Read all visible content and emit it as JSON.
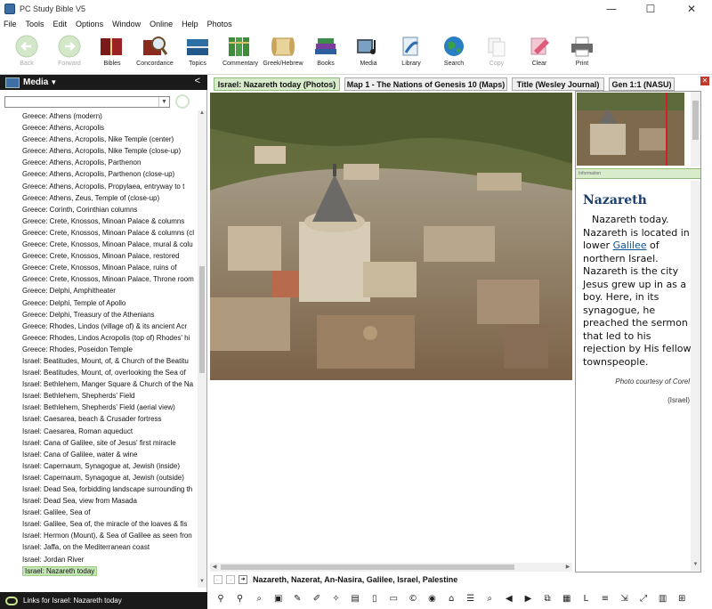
{
  "window": {
    "title": "PC Study Bible V5",
    "controls": {
      "minimize": "—",
      "maximize": "☐",
      "close": "✕"
    }
  },
  "menu": [
    "File",
    "Tools",
    "Edit",
    "Options",
    "Window",
    "Online",
    "Help",
    "Photos"
  ],
  "toolbar": [
    {
      "label": "Back",
      "icon": "back-arrow-icon",
      "enabled": false
    },
    {
      "label": "Forward",
      "icon": "forward-arrow-icon",
      "enabled": false
    },
    {
      "label": "Bibles",
      "icon": "bibles-icon",
      "enabled": true
    },
    {
      "label": "Concordance",
      "icon": "concordance-icon",
      "enabled": true
    },
    {
      "label": "Topics",
      "icon": "topics-icon",
      "enabled": true
    },
    {
      "label": "Commentary",
      "icon": "commentary-icon",
      "enabled": true
    },
    {
      "label": "Greek/Hebrew",
      "icon": "greek-hebrew-icon",
      "enabled": true
    },
    {
      "label": "Books",
      "icon": "books-icon",
      "enabled": true
    },
    {
      "label": "Media",
      "icon": "media-icon",
      "enabled": true
    },
    {
      "label": "Library",
      "icon": "library-icon",
      "enabled": true
    },
    {
      "label": "Search",
      "icon": "search-globe-icon",
      "enabled": true
    },
    {
      "label": "Copy",
      "icon": "copy-icon",
      "enabled": false
    },
    {
      "label": "Clear",
      "icon": "clear-icon",
      "enabled": true
    },
    {
      "label": "Print",
      "icon": "print-icon",
      "enabled": true
    }
  ],
  "left_panel": {
    "title": "Media",
    "collapse": "<",
    "search": {
      "value": "",
      "placeholder": ""
    },
    "items": [
      "Greece: Athens (modern)",
      "Greece: Athens, Acropolis",
      "Greece: Athens, Acropolis, Nike Temple (center)",
      "Greece: Athens, Acropolis, Nike Temple (close-up)",
      "Greece: Athens, Acropolis, Parthenon",
      "Greece: Athens, Acropolis, Parthenon (close-up)",
      "Greece: Athens, Acropolis, Propylaea, entryway to t",
      "Greece: Athens, Zeus, Temple of (close-up)",
      "Greece: Corinth, Corinthian columns",
      "Greece: Crete, Knossos, Minoan Palace & columns",
      "Greece: Crete, Knossos, Minoan Palace & columns (cl",
      "Greece: Crete, Knossos, Minoan Palace, mural & colu",
      "Greece: Crete, Knossos, Minoan Palace, restored",
      "Greece: Crete, Knossos, Minoan Palace, ruins of",
      "Greece: Crete, Knossos, Minoan Palace, Throne room",
      "Greece: Delphi, Amphitheater",
      "Greece: Delphi, Temple of Apollo",
      "Greece: Delphi, Treasury of the Athenians",
      "Greece: Rhodes, Lindos (village of) & its ancient Acr",
      "Greece: Rhodes, Lindos Acropolis (top of) Rhodes' hi",
      "Greece: Rhodes, Poseidon Temple",
      "Israel: Beatitudes, Mount, of, & Church of the Beatitu",
      "Israel: Beatitudes, Mount, of, overlooking the Sea of",
      "Israel: Bethlehem, Manger Square & Church of the Na",
      "Israel: Bethlehem, Shepherds' Field",
      "Israel: Bethlehem, Shepherds' Field (aerial view)",
      "Israel: Caesarea, beach & Crusader fortress",
      "Israel: Caesarea, Roman aqueduct",
      "Israel: Cana of Galilee, site of Jesus' first miracle",
      "Israel: Cana of Galilee, water & wine",
      "Israel: Capernaum, Synagogue at, Jewish (inside)",
      "Israel: Capernaum, Synagogue at, Jewish (outside)",
      "Israel: Dead Sea, forbidding landscape surrounding th",
      "Israel: Dead Sea, view from Masada",
      "Israel: Galilee, Sea of",
      "Israel: Galilee, Sea of, the miracle of the loaves & fis",
      "Israel: Hermon (Mount), & Sea of Galilee as seen fron",
      "Israel: Jaffa, on the Mediterranean coast",
      "Israel: Jordan River",
      "Israel: Nazareth today"
    ],
    "selected_index": 39,
    "footer": "Links for Israel: Nazareth today"
  },
  "tabs": [
    {
      "label": "Israel: Nazareth today (Photos)",
      "active": true
    },
    {
      "label": "Map 1 - The Nations of Genesis 10 (Maps)",
      "active": false
    },
    {
      "label": "Title (Wesley Journal)",
      "active": false
    },
    {
      "label": "Gen 1:1 (NASU)",
      "active": false
    }
  ],
  "tab_close": "✕",
  "info_bar_label": "Information",
  "article": {
    "heading": "Nazareth",
    "body_pre": "Nazareth today. Nazareth is located in lower ",
    "body_link": "Galilee",
    "body_post": " of northern Israel. Nazareth is the city Jesus grew up in as a boy. Here, in its synagogue, he preached the sermon that led to his rejection by His fellow townspeople.",
    "credit": "Photo courtesy of Corel",
    "region": "(Israel)"
  },
  "keywords": "Nazareth, Nazerat, An-Nasira, Galilee, Israel, Palestine",
  "keyword_nav": [
    "←",
    "→",
    "➜"
  ],
  "bottom_icons": [
    {
      "name": "find-icon",
      "glyph": "⚲"
    },
    {
      "name": "zoom-search-icon",
      "glyph": "⚲"
    },
    {
      "name": "zoom-icon",
      "glyph": "⌕"
    },
    {
      "name": "image-icon",
      "glyph": "▣"
    },
    {
      "name": "pen-icon",
      "glyph": "✎"
    },
    {
      "name": "highlight-icon",
      "glyph": "✐"
    },
    {
      "name": "wand-icon",
      "glyph": "✧"
    },
    {
      "name": "note-icon",
      "glyph": "▤"
    },
    {
      "name": "page-icon",
      "glyph": "▯"
    },
    {
      "name": "document-icon",
      "glyph": "▭"
    },
    {
      "name": "copyright-icon",
      "glyph": "©"
    },
    {
      "name": "record-icon",
      "glyph": "◉"
    },
    {
      "name": "bookmark-icon",
      "glyph": "⌂"
    },
    {
      "name": "list-icon",
      "glyph": "☰"
    },
    {
      "name": "magnify-icon",
      "glyph": "⌕"
    },
    {
      "name": "back-icon",
      "glyph": "◀"
    },
    {
      "name": "forward-icon",
      "glyph": "▶"
    },
    {
      "name": "copy-icon",
      "glyph": "⧉"
    },
    {
      "name": "layout-icon",
      "glyph": "▦"
    },
    {
      "name": "letter-l-icon",
      "glyph": "L"
    },
    {
      "name": "lines-icon",
      "glyph": "≡"
    },
    {
      "name": "fit-icon",
      "glyph": "⇲"
    },
    {
      "name": "expand-icon",
      "glyph": "⤢"
    },
    {
      "name": "columns-icon",
      "glyph": "▥"
    },
    {
      "name": "grid-icon",
      "glyph": "⊞"
    }
  ]
}
